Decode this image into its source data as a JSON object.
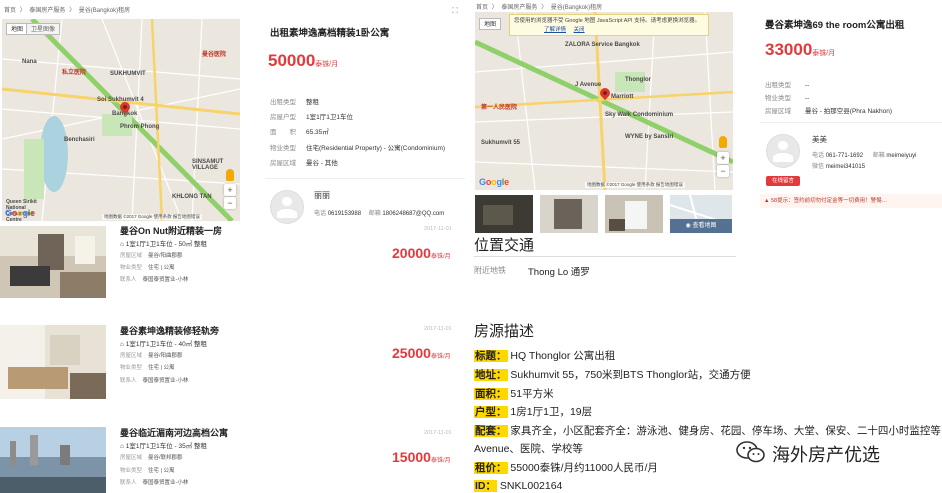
{
  "left": {
    "breadcrumb": [
      "首页",
      "〉",
      "泰国房产服务",
      "〉",
      "曼谷(Bangkok)租房"
    ],
    "map": {
      "tab_map": "地图",
      "tab_satellite": "卫星图像",
      "labels": [
        "Nana",
        "Soi Sukhumvit 4",
        "SUKHUMVIT",
        "SINSAMUT VILLAGE",
        "KHLONG TAN",
        "Queen Sirikit National Convention Centre",
        "Benchasiri",
        "Phrom Phong",
        "Bangkok",
        "私立医院",
        "曼谷医院"
      ],
      "copyright": "地图数据 ©2017 Google  使用条款  报告地图错误"
    },
    "detail": {
      "title": "出租素坤逸高档精装1卧公寓",
      "price": "50000",
      "price_unit": "泰铢/月",
      "rows": [
        {
          "k": "出租类型",
          "v": "整租"
        },
        {
          "k": "房屋户型",
          "v": "1室1厅1卫1车位"
        },
        {
          "k": "面　　积",
          "v": "65.35㎡"
        },
        {
          "k": "物业类型",
          "v": "住宅(Residential Property) - 公寓(Condominium)"
        },
        {
          "k": "房屋区域",
          "v": "曼谷 - 其他"
        }
      ],
      "agent_name": "丽丽",
      "phone_label": "电话",
      "phone": "0619153988",
      "email_label": "邮箱",
      "email": "1806248687@QQ.com"
    },
    "listings": [
      {
        "title": "曼谷On Nut附近精装一房",
        "sub": "1室1厅1卫1车位 - 50㎡ 整租",
        "area_label": "房屋区域",
        "area": "曼谷/阳曲郡郡",
        "type_label": "物业类型",
        "type": "住宅 | 公寓",
        "contact_label": "联系人",
        "contact": "泰国泰贸置业-小林",
        "date": "2017-11-01",
        "price": "20000",
        "unit": "泰铢/月"
      },
      {
        "title": "曼谷素坤逸精装修轻轨旁",
        "sub": "1室1厅1卫1车位 - 40㎡ 整租",
        "area_label": "房屋区域",
        "area": "曼谷/阳曲郡郡",
        "type_label": "物业类型",
        "type": "住宅 | 公寓",
        "contact_label": "联系人",
        "contact": "泰国泰贸置业-小林",
        "date": "2017-11-01",
        "price": "25000",
        "unit": "泰铢/月"
      },
      {
        "title": "曼谷临近湄南河边高档公寓",
        "sub": "1室1厅1卫1车位 - 35㎡ 整租",
        "area_label": "房屋区域",
        "area": "曼谷/联邦郡郡",
        "type_label": "物业类型",
        "type": "住宅 | 公寓",
        "contact_label": "联系人",
        "contact": "泰国泰贸置业-小林",
        "date": "2017-11-01",
        "price": "15000",
        "unit": "泰铢/月"
      }
    ]
  },
  "right": {
    "breadcrumb": [
      "首页",
      "〉",
      "泰国房产服务",
      "〉",
      "曼谷(Bangkok)租房"
    ],
    "map": {
      "tab_map": "地图",
      "warning": "您使用的浏览器不受 Google 地图 JavaScript API 支持。请考虑更换浏览器。",
      "warning_link1": "了解详情",
      "warning_link2": "关闭",
      "labels": [
        "ZALORA Service Bangkok",
        "Thonglor",
        "Sky Walk Condominium",
        "WYNE by Sansiri",
        "Marriott",
        "Sukhumvit 55",
        "第一人民医院",
        "J Avenue"
      ],
      "copyright": "地图数据 ©2017 Google  使用条款  报告地图错误"
    },
    "detail": {
      "title": "曼谷素坤逸69 the room公寓出租",
      "price": "33000",
      "price_unit": "泰铢/月",
      "rows": [
        {
          "k": "出租类型",
          "v": "--"
        },
        {
          "k": "物业类型",
          "v": "--"
        },
        {
          "k": "房屋区域",
          "v": "曼谷 - 拍那空县(Phra Nakhon)"
        }
      ],
      "agent_name": "美美",
      "phone_label": "电话",
      "phone": "061-771-1692",
      "email_label": "邮箱",
      "email": "meimeiyuyi",
      "wechat_label": "微信",
      "wechat": "meimei341015",
      "online_btn": "在线留言",
      "tip": "58提示：签约前切勿付定金等一切费用！警惕…"
    },
    "view_map_btn": "查看地图",
    "traffic": {
      "heading": "位置交通",
      "near_label": "附近地铁",
      "near_value": "Thong Lo 通罗"
    },
    "description": {
      "heading": "房源描述",
      "lines": [
        {
          "label": "标题：",
          "text": "HQ Thonglor 公寓出租"
        },
        {
          "label": "地址：",
          "text": "Sukhumvit 55，750米到BTS Thonglor站，交通方便"
        },
        {
          "label": "面积：",
          "text": "51平方米"
        },
        {
          "label": "户型：",
          "text": "1房1厅1卫，19层"
        },
        {
          "label": "配套：",
          "text": "家具齐全，小区配套齐全：游泳池、健身房、花园、停车场、大堂、保安、二十四小时监控等，周边有J"
        },
        {
          "label": "",
          "text": "Avenue、医院、学校等"
        },
        {
          "label": "租价：",
          "text": "55000泰铢/月约11000人民币/月"
        },
        {
          "label": "ID：",
          "text": "SNKL002164"
        }
      ]
    },
    "watermark": "海外房产优选"
  },
  "colors": {
    "price_red": "#e4393c",
    "highlight": "#ffd800",
    "road_green": "#8fd06a"
  }
}
